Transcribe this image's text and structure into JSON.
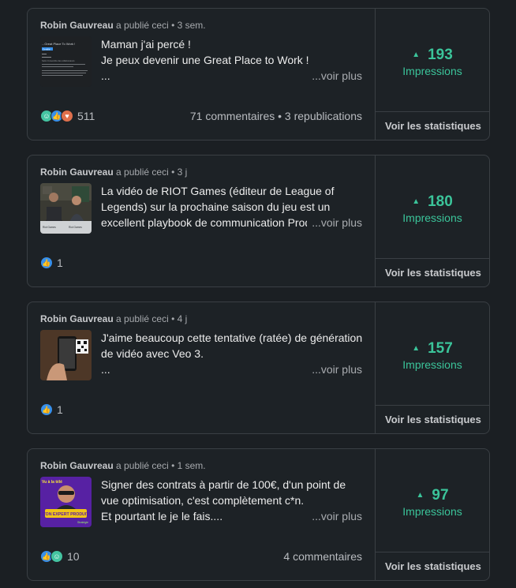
{
  "posts": [
    {
      "author": "Robin Gauvreau",
      "action": " a publié ceci • ",
      "age": "3 sem.",
      "text_lines": [
        "Maman j'ai percé !",
        "Je peux devenir une Great Place to Work !",
        "..."
      ],
      "voir_plus": "...voir plus",
      "reaction_icons": [
        "fun",
        "like",
        "love"
      ],
      "reaction_count": "511",
      "comments": "71 commentaires • 3 republications",
      "impressions": "193",
      "impressions_label": "Impressions",
      "stats_button": "Voir les statistiques"
    },
    {
      "author": "Robin Gauvreau",
      "action": " a publié ceci • ",
      "age": "3 j",
      "text_lines": [
        "La vidéo de RIOT Games (éditeur de League of",
        "Legends) sur la prochaine saison du jeu est un",
        "excellent playbook de communication Prod"
      ],
      "voir_plus": "...voir plus",
      "reaction_icons": [
        "like"
      ],
      "reaction_count": "1",
      "comments": "",
      "impressions": "180",
      "impressions_label": "Impressions",
      "stats_button": "Voir les statistiques"
    },
    {
      "author": "Robin Gauvreau",
      "action": " a publié ceci • ",
      "age": "4 j",
      "text_lines": [
        "J'aime beaucoup cette tentative (ratée) de génération",
        "de vidéo avec Veo 3.",
        "..."
      ],
      "voir_plus": "...voir plus",
      "reaction_icons": [
        "like"
      ],
      "reaction_count": "1",
      "comments": "",
      "impressions": "157",
      "impressions_label": "Impressions",
      "stats_button": "Voir les statistiques"
    },
    {
      "author": "Robin Gauvreau",
      "action": " a publié ceci • ",
      "age": "1 sem.",
      "text_lines": [
        "Signer des contrats à partir de 100€, d'un point de",
        "vue optimisation, c'est complètement c*n.",
        "Et pourtant le je le fais...."
      ],
      "voir_plus": "...voir plus",
      "reaction_icons": [
        "like",
        "fun"
      ],
      "reaction_count": "10",
      "comments": "4 commentaires",
      "impressions": "97",
      "impressions_label": "Impressions",
      "stats_button": "Voir les statistiques"
    }
  ],
  "thumbnails": {
    "post1": {
      "header": "...Great Place To Work !",
      "tag": "Certifié",
      "text": "Selon l'ensemble des collaborateurs"
    },
    "post2": {
      "caption_left": "Riot Games",
      "caption_right": "Riot Games"
    },
    "post4": {
      "top": "Vu à la télé",
      "title": "TON EXPERT PRODUIT",
      "sub": "Stratégie"
    }
  },
  "colors": {
    "background": "#1b1f23",
    "card": "#1d2226",
    "border": "#3a3f44",
    "accent_green": "#3bc49a",
    "like": "#378fe9",
    "fun": "#44c4a1",
    "love": "#df704d"
  }
}
